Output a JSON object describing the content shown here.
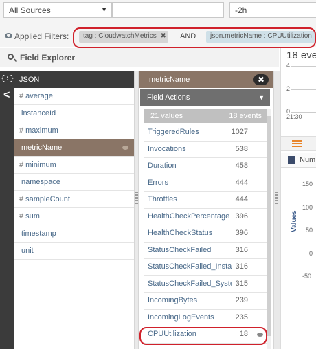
{
  "toolbar": {
    "source_label": "All Sources",
    "query_value": "",
    "time_value": "-2h"
  },
  "filters": {
    "label": "Applied Filters:",
    "chip1": "tag : CloudwatchMetrics",
    "chip1_close": "✖",
    "and_label": "AND",
    "chip2": "json.metricName : CPUUtilization"
  },
  "explorer": {
    "title": "Field Explorer",
    "json_icon": "{:}",
    "json_label": "JSON",
    "collapse_icon": "<",
    "fields": [
      {
        "prefix": "#",
        "name": "average"
      },
      {
        "prefix": "",
        "name": "instanceId"
      },
      {
        "prefix": "#",
        "name": "maximum"
      },
      {
        "prefix": "",
        "name": "metricName"
      },
      {
        "prefix": "#",
        "name": "minimum"
      },
      {
        "prefix": "",
        "name": "namespace"
      },
      {
        "prefix": "#",
        "name": "sampleCount"
      },
      {
        "prefix": "#",
        "name": "sum"
      },
      {
        "prefix": "",
        "name": "timestamp"
      },
      {
        "prefix": "",
        "name": "unit"
      }
    ]
  },
  "values_panel": {
    "title": "metricName",
    "close": "✖",
    "field_actions": "Field Actions",
    "values_count": "21 values",
    "events_count": "18 events",
    "rows": [
      {
        "name": "TriggeredRules",
        "count": "1027"
      },
      {
        "name": "Invocations",
        "count": "538"
      },
      {
        "name": "Duration",
        "count": "458"
      },
      {
        "name": "Errors",
        "count": "444"
      },
      {
        "name": "Throttles",
        "count": "444"
      },
      {
        "name": "HealthCheckPercentage",
        "count": "396"
      },
      {
        "name": "HealthCheckStatus",
        "count": "396"
      },
      {
        "name": "StatusCheckFailed",
        "count": "316"
      },
      {
        "name": "StatusCheckFailed_Instance",
        "count": "316"
      },
      {
        "name": "StatusCheckFailed_System",
        "count": "315"
      },
      {
        "name": "IncomingBytes",
        "count": "239"
      },
      {
        "name": "IncomingLogEvents",
        "count": "235"
      },
      {
        "name": "CPUUtilization",
        "count": "18"
      }
    ]
  },
  "right_panel": {
    "events_title": "18 eve",
    "mini_ticks": [
      "4",
      "2",
      "0"
    ],
    "mini_time": "21:30",
    "legend_label": "Num",
    "y_ticks": [
      "150",
      "100",
      "50",
      "0",
      "-50"
    ],
    "y_label": "Values"
  },
  "colors": {
    "selected_field": "#8a7566",
    "highlight_circle": "#d0212b",
    "dark_sidebar": "#3b3b3b"
  }
}
